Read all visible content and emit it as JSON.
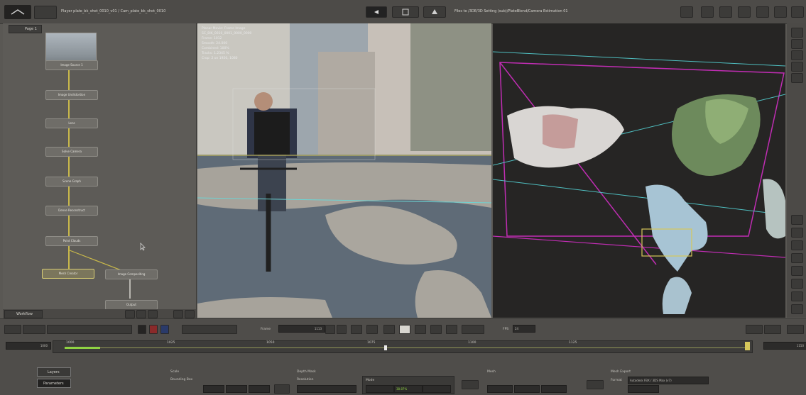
{
  "app": {
    "file_title": "Player plate_bk_shot_0010_v01 / Cam_plate_bk_shot_0010",
    "path_label": "Files to /3DE/3D Setting (sub)/PlateBlend/Camera Estimation 01",
    "hud_lines": [
      "Planar Movie: Frame Image",
      "SC_BIK_0010_0001_0000_0000",
      "Frame: 1012",
      "Smooth: 24.000",
      "Combined: 100%",
      "Tracks: 1.2345 %",
      "Crop: 2 on 1920, 1080"
    ]
  },
  "node_panel": {
    "tab_label": "Page 1",
    "nodes": [
      {
        "label": "Image Source 1"
      },
      {
        "label": "Image Undistortion"
      },
      {
        "label": "Lens"
      },
      {
        "label": "Solve Camera"
      },
      {
        "label": "Scene Graph"
      },
      {
        "label": "Dense Reconstruct"
      },
      {
        "label": "Point Clouds"
      },
      {
        "label": "Mesh Creator"
      },
      {
        "label": "Image Compositing"
      },
      {
        "label": "Output"
      }
    ],
    "status_label": "Workflow"
  },
  "timeline": {
    "start_frame": "1000",
    "end_frame": "1150",
    "frame_label": "Frame",
    "current_frame": "1113",
    "fps_label": "FPS",
    "fps_value": "24",
    "ticks": [
      "1000",
      "1025",
      "1050",
      "1075",
      "1100",
      "1125"
    ]
  },
  "bottom": {
    "left_buttons": [
      "Layers",
      "Parameters"
    ],
    "groups": [
      {
        "title": "Scale"
      },
      {
        "title": "Depth Mask"
      },
      {
        "title": "Mesh"
      },
      {
        "title": "Mesh Export"
      }
    ],
    "field_labels": [
      "Bounding Box",
      "Resolution",
      "Mode",
      "Format"
    ],
    "export_format": "Autodesk FBX / 3DS Max (v7)",
    "percent_value": "38.87%"
  },
  "colors": {
    "accent": "#d6c75a",
    "viewport_bg": "#262524",
    "panel_bg": "#5d5b57",
    "cam_frustum": "#c02db3",
    "cam_lines": "#4fbfc1"
  }
}
